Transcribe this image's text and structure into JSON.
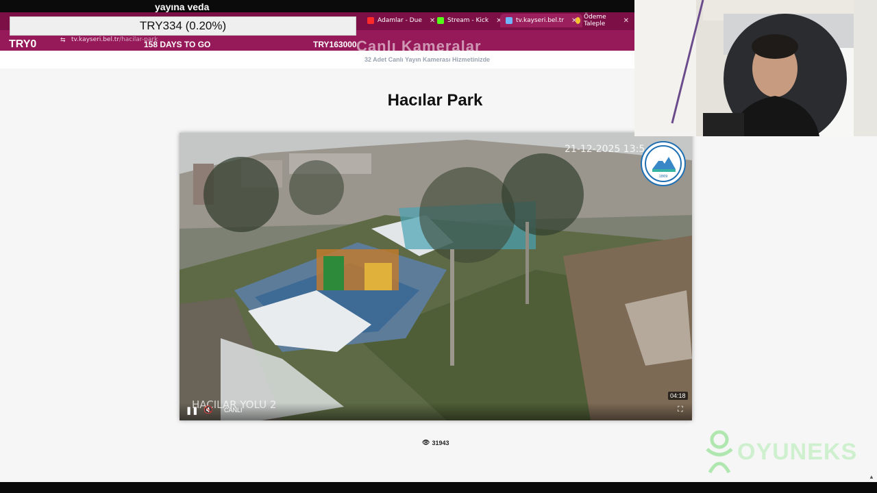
{
  "overlay": {
    "stream_title": "yayına veda",
    "goal_value": "TRY334 (0.20%)",
    "goal_start": "TRY0",
    "days_left": "158 DAYS TO GO",
    "goal_target": "TRY163000"
  },
  "browser": {
    "url_domain": "tv.kayseri.bel.tr",
    "url_path": "/hacilar-park",
    "tabs": [
      {
        "label": "Adamlar - Due",
        "icon": "youtube-icon",
        "color": "#ff2a2a"
      },
      {
        "label": "Stream - Kick",
        "icon": "kick-icon",
        "color": "#53fc18"
      },
      {
        "label": "tv.kayseri.bel.tr",
        "icon": "site-icon",
        "color": "#6fb5ff"
      },
      {
        "label": "Ödeme Taleple",
        "icon": "payment-icon",
        "color": "#f2c230"
      }
    ]
  },
  "page": {
    "site_heading": "Canlı Kameralar",
    "site_subheading": "32 Adet Canlı Yayın Kamerası Hizmetinizde",
    "title": "Hacılar Park",
    "viewer_count": "31943"
  },
  "video": {
    "timestamp": "21-12-2025 13:5",
    "camera_name": "HACILAR YOLU 2",
    "live_label": "CANLI",
    "duration": "04:18",
    "logo_text": "KAYSERİ BÜYÜKŞEHİR BELEDİYESİ",
    "logo_year": "1869"
  },
  "watermark": {
    "brand": "OYUNEKS"
  },
  "colors": {
    "browser_theme": "#7a1048",
    "brand_green": "#9fe39f",
    "logo_blue": "#1f6fb3"
  }
}
